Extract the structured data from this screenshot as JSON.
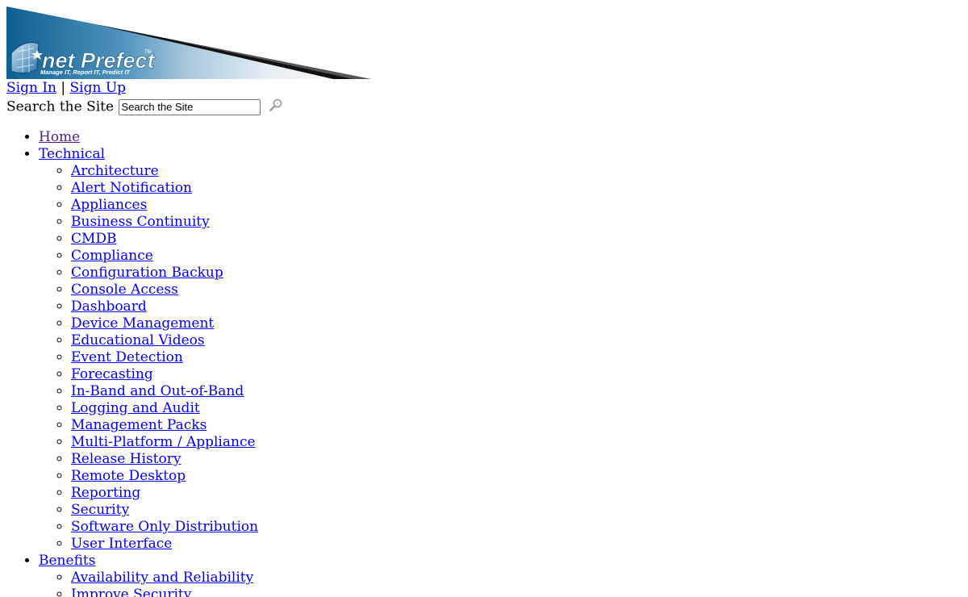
{
  "logo": {
    "brand": "net Prefect",
    "trademark": "TM",
    "tagline": "Manage IT, Report IT, Predict IT"
  },
  "auth": {
    "sign_in": "Sign In",
    "separator": "|",
    "sign_up": "Sign Up"
  },
  "search": {
    "label": "Search the Site",
    "value": "Search the Site",
    "button_icon": "magnifier-icon"
  },
  "colors": {
    "link": "#0000ee",
    "visited_link": "#551a8b",
    "logo_blue": "#1f6fa0"
  },
  "nav": {
    "home": "Home",
    "technical": "Technical",
    "technical_items": [
      "Architecture",
      "Alert Notification",
      "Appliances",
      "Business Continuity",
      "CMDB",
      "Compliance",
      "Configuration Backup",
      "Console Access",
      "Dashboard",
      "Device Management",
      "Educational Videos",
      "Event Detection",
      "Forecasting",
      "In-Band and Out-of-Band",
      "Logging and Audit",
      "Management Packs",
      "Multi-Platform / Appliance",
      "Release History",
      "Remote Desktop",
      "Reporting",
      "Security",
      "Software Only Distribution",
      "User Interface"
    ],
    "benefits": "Benefits",
    "benefits_items": [
      "Availability and Reliability",
      "Improve Security"
    ]
  }
}
